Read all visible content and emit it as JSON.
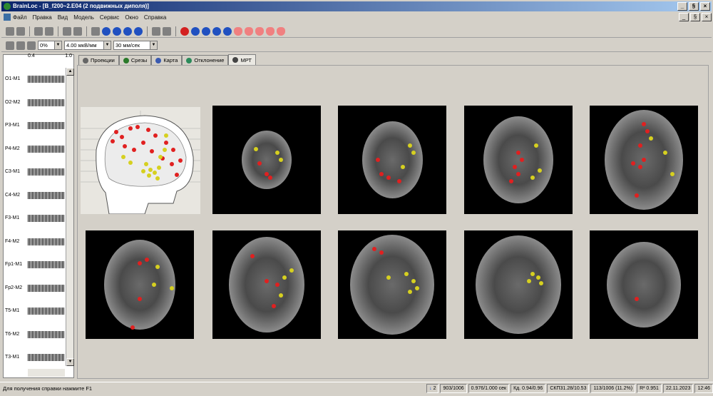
{
  "window": {
    "title": "BrainLoc - [B_f200~2.E04 (2 подвижных диполя)]",
    "min": "_",
    "max": "§",
    "close": "×"
  },
  "menu": {
    "items": [
      "Файл",
      "Правка",
      "Вид",
      "Модель",
      "Сервис",
      "Окно",
      "Справка"
    ]
  },
  "toolbar2": {
    "zoom": "0%",
    "sensitivity": "4.00 мкВ/мм",
    "speed": "30 мм/сек"
  },
  "left_panel": {
    "ruler": [
      "0.4",
      "1.0"
    ],
    "channels": [
      "O1-M1",
      "O2-M2",
      "P3-M1",
      "P4-M2",
      "C3-M1",
      "C4-M2",
      "F3-M1",
      "F4-M2",
      "Fp1-M1",
      "Fp2-M2",
      "T5-M1",
      "T6-M2",
      "T3-M1"
    ]
  },
  "tabs": [
    {
      "label": "Проекции",
      "icon": "projection-icon"
    },
    {
      "label": "Срезы",
      "icon": "slices-icon"
    },
    {
      "label": "Карта",
      "icon": "map-icon"
    },
    {
      "label": "Отклонение",
      "icon": "deviation-icon"
    },
    {
      "label": "МРТ",
      "icon": "mri-icon",
      "active": true
    }
  ],
  "status": {
    "help": "Для получения справки нажмите F1",
    "count": "2",
    "segment": "903/1006",
    "time": "0.976/1.000 сек",
    "kd": "Кд. 0.94/0.96",
    "skp": "СКП31.28/10.53",
    "pct": "113/1006 (11.2%)",
    "r2": "R² 0.951",
    "date": "22.11.2023",
    "time_clock": "12:46"
  },
  "colors": {
    "dipole_red": "#e02020",
    "dipole_yellow": "#d6d020"
  }
}
